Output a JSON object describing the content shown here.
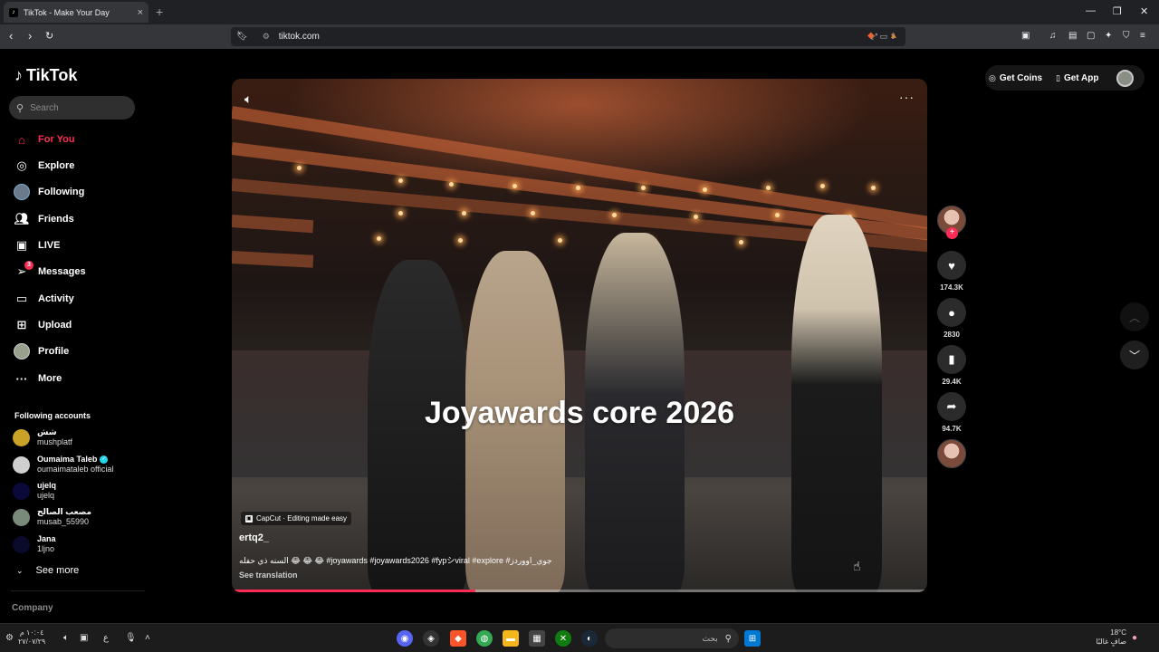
{
  "browser": {
    "tab_title": "TikTok - Make Your Day",
    "tab_close": "×",
    "new_tab": "+",
    "url": "tiktok.com",
    "window_controls": [
      "—",
      "❐",
      "✕"
    ]
  },
  "sidebar": {
    "logo": "TikTok",
    "search_placeholder": "Search",
    "nav": [
      {
        "label": "For You",
        "icon": "home-icon",
        "active": true
      },
      {
        "label": "Explore",
        "icon": "compass-icon"
      },
      {
        "label": "Following",
        "icon": "following-avatar"
      },
      {
        "label": "Friends",
        "icon": "friends-icon"
      },
      {
        "label": "LIVE",
        "icon": "live-icon"
      },
      {
        "label": "Messages",
        "icon": "messages-icon",
        "badge": "3"
      },
      {
        "label": "Activity",
        "icon": "activity-icon"
      },
      {
        "label": "Upload",
        "icon": "upload-icon"
      },
      {
        "label": "Profile",
        "icon": "profile-avatar"
      },
      {
        "label": "More",
        "icon": "more-icon"
      }
    ],
    "following_title": "Following accounts",
    "accounts": [
      {
        "display": "شش",
        "username": "mushplatf",
        "color": "#c9a227"
      },
      {
        "display": "Oumaima Taleb",
        "username": "oumaimataleb official",
        "verified": true,
        "color": "#cfcfcf"
      },
      {
        "display": "ujelq",
        "username": "ujelq",
        "color": "#0a0a3a"
      },
      {
        "display": "مصعب الصالح",
        "username": "musab_55990",
        "color": "#7a8a7a"
      },
      {
        "display": "Jana",
        "username": "1ljno",
        "color": "#0a0a2a"
      }
    ],
    "see_more": "See more",
    "company": "Company"
  },
  "video": {
    "overlay_text": "Joyawards core 2026",
    "capcut_label": "CapCut · Editing made easy",
    "author": "ertq2_",
    "caption": "السنه ذي حفله 😂 😂 😂 #joyawards #joyawards2026 #fypシviral #explore #جوي_اووردز",
    "see_translation": "See translation",
    "progress": 0.35
  },
  "actions": {
    "likes": "174.3K",
    "comments": "2830",
    "saves": "29.4K",
    "shares": "94.7K"
  },
  "topright": {
    "get_coins": "Get Coins",
    "get_app": "Get App"
  },
  "taskbar": {
    "search_placeholder": "بحث",
    "clock_time": "١٠:٠٤ م",
    "clock_date": "٢٧/٠٧/٢٩",
    "weather_temp": "18°C",
    "weather_desc": "صافٍ غالبًا",
    "lang": "ع"
  }
}
